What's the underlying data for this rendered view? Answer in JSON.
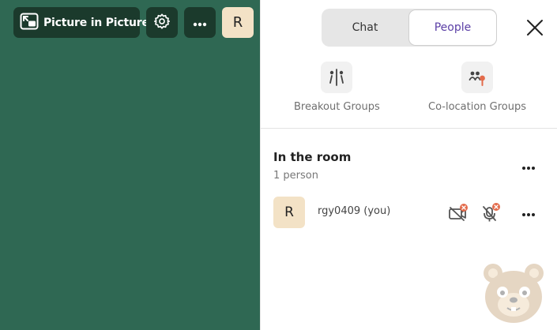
{
  "stage": {
    "pip_label": "Picture in Picture",
    "avatar_initial": "R",
    "background_color": "#2f6853"
  },
  "panel": {
    "tabs": [
      {
        "label": "Chat"
      },
      {
        "label": "People"
      }
    ],
    "groups": [
      {
        "label": "Breakout Groups"
      },
      {
        "label": "Co-location Groups"
      }
    ],
    "room": {
      "title": "In the room",
      "count": "1 person",
      "participants": [
        {
          "initial": "R",
          "name": "rgy0409 (you)"
        }
      ]
    }
  },
  "icons": [
    "picture-in-picture-icon",
    "gear-icon",
    "more-icon",
    "close-icon",
    "breakout-icon",
    "colocation-icon",
    "camera-off-icon",
    "mic-off-icon",
    "bear-watermark"
  ],
  "colors": {
    "accent": "#5b3fa6",
    "dark_button": "#1b3a2c",
    "avatar_bg": "#f3e2c6",
    "muted_badge": "#e36b4b"
  }
}
